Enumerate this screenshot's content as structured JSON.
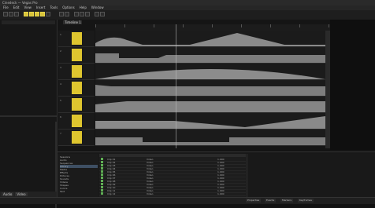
{
  "window": {
    "title": "Cinedeck — Vegas Pro"
  },
  "menu": [
    "File",
    "Edit",
    "View",
    "Insert",
    "Tools",
    "Options",
    "Help",
    "Window"
  ],
  "timeline_tab": {
    "label": "Timeline 1"
  },
  "ruler": {
    "ticks": [
      "00:00:00",
      "00:00:05",
      "00:00:10",
      "00:00:15",
      "00:00:20",
      "00:00:25",
      "00:00:30",
      "00:00:35",
      "00:00:40"
    ]
  },
  "tracks": [
    {
      "label": "1"
    },
    {
      "label": "2"
    },
    {
      "label": "3"
    },
    {
      "label": "4"
    },
    {
      "label": "5"
    },
    {
      "label": "6"
    },
    {
      "label": "7"
    }
  ],
  "tree": {
    "rows": [
      "Sessions",
      "Audio",
      "Sequences",
      "Library",
      "Media",
      "Effects",
      "Pictures",
      "Sounds",
      "Videos",
      "Shapes",
      "Colors",
      "Text"
    ],
    "selected_index": 3
  },
  "list": {
    "rows": [
      {
        "name": "Clip 01",
        "type": "Video",
        "value": "1.000"
      },
      {
        "name": "Clip 02",
        "type": "Video",
        "value": "1.000"
      },
      {
        "name": "Clip 03",
        "type": "Video",
        "value": "1.000"
      },
      {
        "name": "Clip 04",
        "type": "Video",
        "value": "1.000"
      },
      {
        "name": "Clip 05",
        "type": "Video",
        "value": "1.000"
      },
      {
        "name": "Clip 06",
        "type": "Video",
        "value": "1.000"
      },
      {
        "name": "Clip 07",
        "type": "Video",
        "value": "1.000"
      },
      {
        "name": "Clip 08",
        "type": "Video",
        "value": "1.000"
      },
      {
        "name": "Clip 09",
        "type": "Video",
        "value": "1.000"
      },
      {
        "name": "Clip 10",
        "type": "Video",
        "value": "1.000"
      },
      {
        "name": "Clip 11",
        "type": "Video",
        "value": "1.000"
      },
      {
        "name": "Clip 12",
        "type": "Video",
        "value": "1.000"
      }
    ]
  },
  "left_tabs": [
    "Audio",
    "Video"
  ],
  "statusbar": [
    "Properties",
    "Events",
    "Markers",
    "Keyframes"
  ],
  "colors": {
    "track_swatch": "#dfc62f",
    "selection": "#3e4f63"
  }
}
